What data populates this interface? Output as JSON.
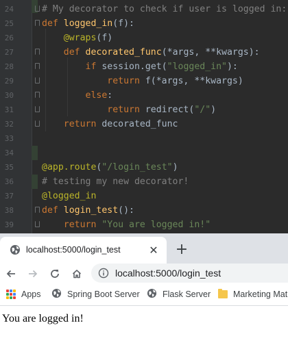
{
  "editor": {
    "lines": [
      {
        "num": "24",
        "tokens": [
          {
            "t": "# My decorator to check if user is logged in:",
            "c": "cm"
          }
        ]
      },
      {
        "num": "25",
        "tokens": [
          {
            "t": "def ",
            "c": "kw"
          },
          {
            "t": "logged_in",
            "c": "fn"
          },
          {
            "t": "(f):",
            "c": ""
          }
        ]
      },
      {
        "num": "26",
        "tokens": [
          {
            "t": "    ",
            "c": ""
          },
          {
            "t": "@wraps",
            "c": "dec"
          },
          {
            "t": "(f)",
            "c": ""
          }
        ]
      },
      {
        "num": "27",
        "tokens": [
          {
            "t": "    ",
            "c": ""
          },
          {
            "t": "def ",
            "c": "kw"
          },
          {
            "t": "decorated_func",
            "c": "fn"
          },
          {
            "t": "(*args, **kwargs):",
            "c": ""
          }
        ]
      },
      {
        "num": "28",
        "tokens": [
          {
            "t": "        ",
            "c": ""
          },
          {
            "t": "if ",
            "c": "kw"
          },
          {
            "t": "session.get(",
            "c": ""
          },
          {
            "t": "\"logged_in\"",
            "c": "str"
          },
          {
            "t": "):",
            "c": ""
          }
        ]
      },
      {
        "num": "29",
        "tokens": [
          {
            "t": "            ",
            "c": ""
          },
          {
            "t": "return ",
            "c": "kw"
          },
          {
            "t": "f(*args, **kwargs)",
            "c": ""
          }
        ]
      },
      {
        "num": "30",
        "tokens": [
          {
            "t": "        ",
            "c": ""
          },
          {
            "t": "else",
            "c": "kw"
          },
          {
            "t": ":",
            "c": ""
          }
        ]
      },
      {
        "num": "31",
        "tokens": [
          {
            "t": "            ",
            "c": ""
          },
          {
            "t": "return ",
            "c": "kw"
          },
          {
            "t": "redirect(",
            "c": ""
          },
          {
            "t": "\"/\"",
            "c": "str"
          },
          {
            "t": ")",
            "c": ""
          }
        ]
      },
      {
        "num": "32",
        "tokens": [
          {
            "t": "    ",
            "c": ""
          },
          {
            "t": "return ",
            "c": "kw"
          },
          {
            "t": "decorated_func",
            "c": ""
          }
        ]
      },
      {
        "num": "33",
        "tokens": []
      },
      {
        "num": "34",
        "tokens": []
      },
      {
        "num": "35",
        "tokens": [
          {
            "t": "@app.route",
            "c": "dec"
          },
          {
            "t": "(",
            "c": ""
          },
          {
            "t": "\"/login_test\"",
            "c": "str"
          },
          {
            "t": ")",
            "c": ""
          }
        ]
      },
      {
        "num": "36",
        "tokens": [
          {
            "t": "# testing my new decorator!",
            "c": "cm"
          }
        ]
      },
      {
        "num": "37",
        "tokens": [
          {
            "t": "@logged_in",
            "c": "dec"
          }
        ]
      },
      {
        "num": "38",
        "tokens": [
          {
            "t": "def ",
            "c": "kw"
          },
          {
            "t": "login_test",
            "c": "fn"
          },
          {
            "t": "():",
            "c": ""
          }
        ]
      },
      {
        "num": "39",
        "tokens": [
          {
            "t": "    ",
            "c": ""
          },
          {
            "t": "return ",
            "c": "kw"
          },
          {
            "t": "\"You are logged in!\"",
            "c": "str"
          }
        ]
      }
    ]
  },
  "browser": {
    "tab_title": "localhost:5000/login_test",
    "close_label": "✕",
    "new_tab_label": "+",
    "url": "localhost:5000/login_test",
    "bookmarks": [
      {
        "label": "Apps",
        "icon": "apps-icon"
      },
      {
        "label": "Spring Boot Server",
        "icon": "globe-icon"
      },
      {
        "label": "Flask Server",
        "icon": "globe-icon"
      },
      {
        "label": "Marketing Mat",
        "icon": "folder-icon"
      }
    ]
  },
  "page": {
    "body_text": "You are logged in!"
  },
  "colors": {
    "editor_bg": "#2b2b2b",
    "keyword": "#cc7832",
    "function": "#ffc66d",
    "string": "#6a8759",
    "comment": "#808080",
    "decorator": "#bbb529",
    "tabbar_bg": "#dee1e6"
  }
}
